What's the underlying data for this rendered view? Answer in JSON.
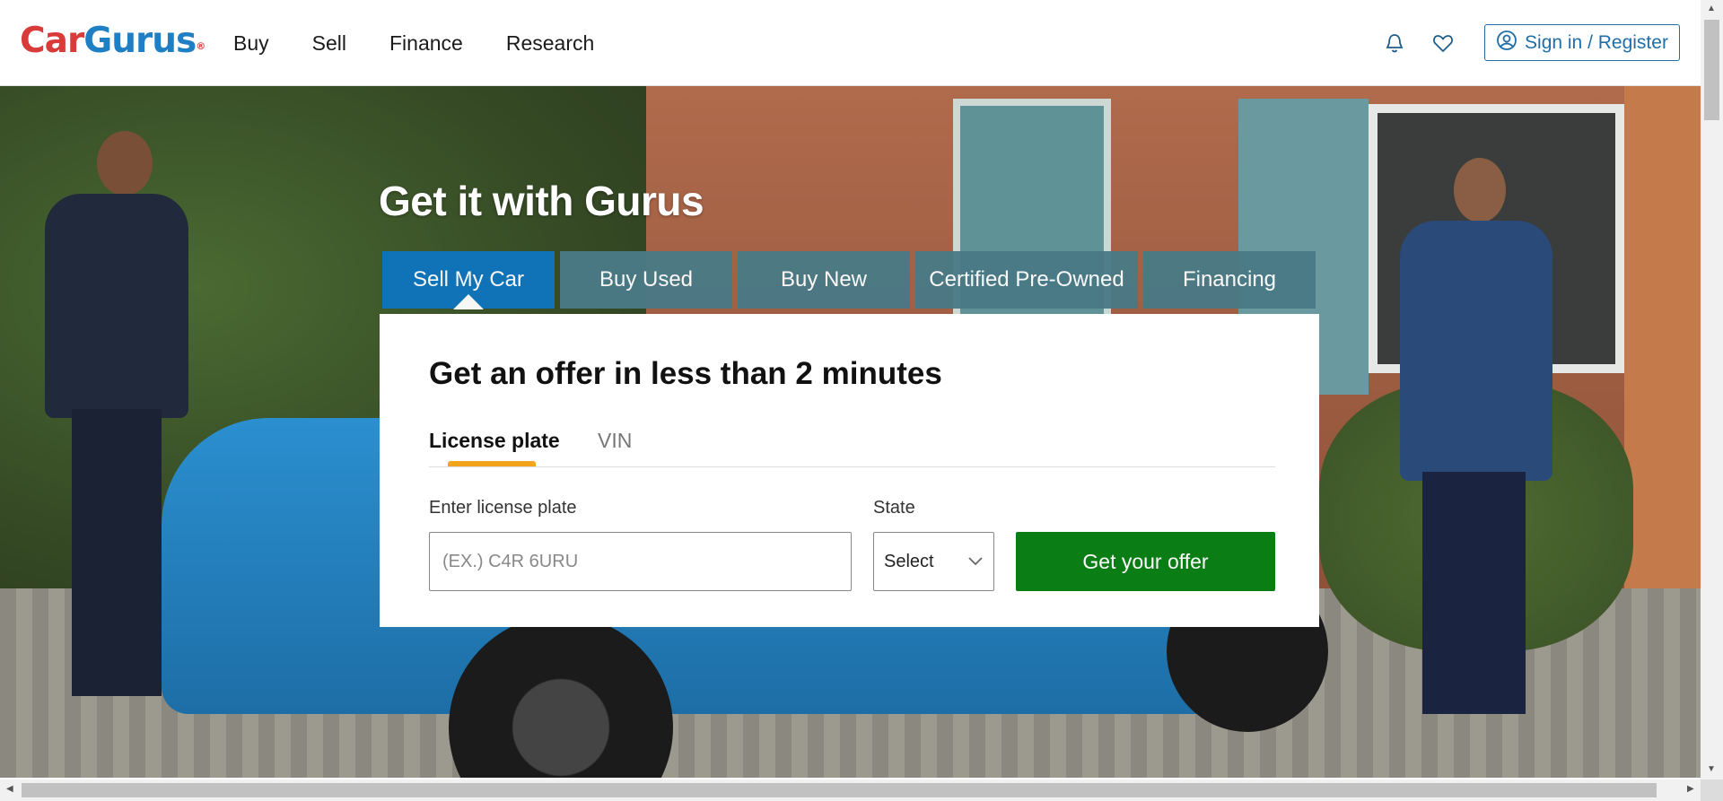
{
  "brand": {
    "part1": "Car",
    "part2": "Gurus",
    "reg": "®"
  },
  "nav": {
    "items": [
      "Buy",
      "Sell",
      "Finance",
      "Research"
    ]
  },
  "header": {
    "signin_label": "Sign in / Register"
  },
  "hero": {
    "title": "Get it with Gurus"
  },
  "tabs": [
    {
      "label": "Sell My Car",
      "active": true
    },
    {
      "label": "Buy Used",
      "active": false
    },
    {
      "label": "Buy New",
      "active": false
    },
    {
      "label": "Certified Pre-Owned",
      "active": false
    },
    {
      "label": "Financing",
      "active": false
    }
  ],
  "offer_card": {
    "title": "Get an offer in less than 2 minutes",
    "subtabs": [
      "License plate",
      "VIN"
    ],
    "plate_label": "Enter license plate",
    "plate_placeholder": "(EX.) C4R 6URU",
    "plate_value": "",
    "state_label": "State",
    "state_value": "Select",
    "submit_label": "Get your offer"
  },
  "colors": {
    "brand_red": "#d93a3a",
    "brand_blue": "#1e7fc4",
    "active_tab": "#0f74bd",
    "inactive_tab": "#4a7a86",
    "cta_green": "#0a7d14",
    "subtab_underline": "#f2a41c"
  },
  "icons": [
    "bell-icon",
    "heart-icon",
    "user-circle-icon",
    "chevron-down-icon"
  ]
}
